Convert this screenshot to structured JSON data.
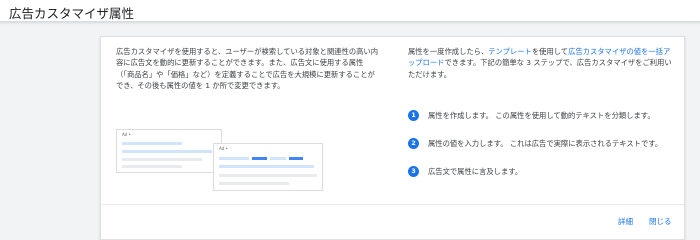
{
  "header": {
    "title": "広告カスタマイザ属性"
  },
  "card": {
    "description": "広告カスタマイザを使用すると、ユーザーが検索している対象と関連性の高い内容に広告文を動的に更新することができます。また、広告文に使用する属性（「商品名」や「価格」など）を定義することで広告を大規模に更新することができ、その後も属性の値を 1 か所で変更できます。",
    "illustration": {
      "ad_label": "Ad •"
    },
    "intro_before": "属性を一度作成したら、",
    "intro_link_template": "テンプレート",
    "intro_middle": "を使用して",
    "intro_link_upload": "広告カスタマイザの値を一括アップロード",
    "intro_after": "できます。下記の簡単な 3 ステップで、広告カスタマイザをご利用いただけます。",
    "steps": [
      {
        "number": "1",
        "text": "属性を作成します。 この属性を使用して動的テキストを分類します。"
      },
      {
        "number": "2",
        "text": "属性の値を入力します。 これは広告で実際に表示されるテキストです。"
      },
      {
        "number": "3",
        "text": "広告文で属性に言及します。"
      }
    ],
    "actions": {
      "details_label": "詳細",
      "close_label": "閉じる"
    }
  },
  "colors": {
    "accent": "#1a73e8",
    "background": "#f1f3f4",
    "card": "#ffffff"
  }
}
